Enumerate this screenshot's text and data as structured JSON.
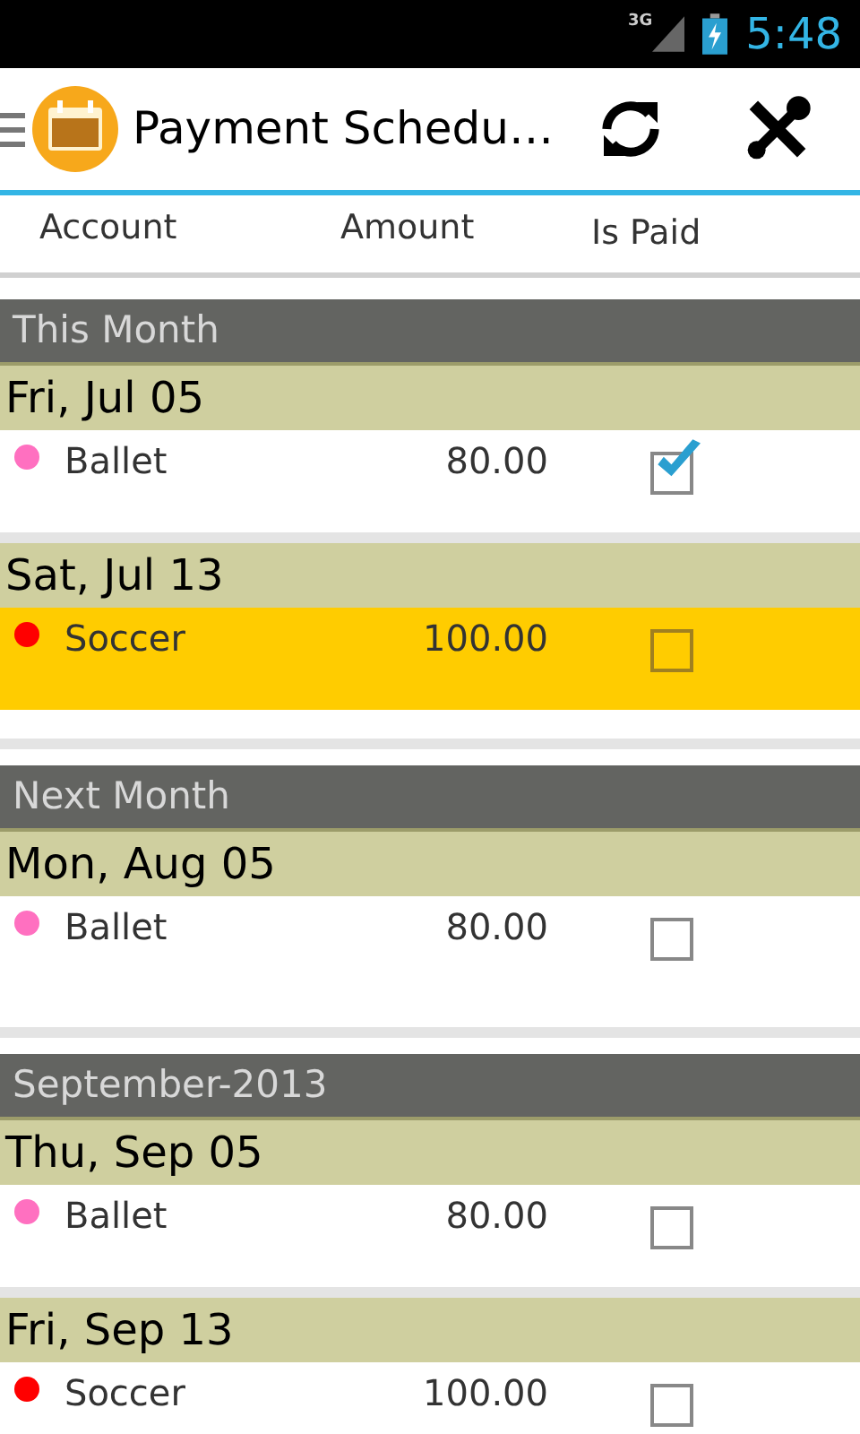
{
  "status_bar": {
    "network": "3G",
    "time": "5:48"
  },
  "action_bar": {
    "title": "Payment Schedu…"
  },
  "columns": [
    "Account",
    "Amount",
    "Is Paid"
  ],
  "sections": [
    {
      "title": "This Month",
      "dates": [
        {
          "date": "Fri, Jul 05",
          "payments": [
            {
              "account": "Ballet",
              "amount": "80.00",
              "paid": true,
              "selected": false,
              "color": "#ff70c0"
            }
          ]
        },
        {
          "date": "Sat, Jul 13",
          "payments": [
            {
              "account": "Soccer",
              "amount": "100.00",
              "paid": false,
              "selected": true,
              "color": "#ff0000"
            }
          ]
        }
      ]
    },
    {
      "title": "Next Month",
      "dates": [
        {
          "date": "Mon, Aug 05",
          "payments": [
            {
              "account": "Ballet",
              "amount": "80.00",
              "paid": false,
              "selected": false,
              "color": "#ff70c0"
            }
          ]
        }
      ]
    },
    {
      "title": "September-2013",
      "dates": [
        {
          "date": "Thu, Sep 05",
          "payments": [
            {
              "account": "Ballet",
              "amount": "80.00",
              "paid": false,
              "selected": false,
              "color": "#ff70c0"
            }
          ]
        },
        {
          "date": "Fri, Sep 13",
          "payments": [
            {
              "account": "Soccer",
              "amount": "100.00",
              "paid": false,
              "selected": false,
              "color": "#ff0000"
            }
          ]
        }
      ]
    }
  ]
}
